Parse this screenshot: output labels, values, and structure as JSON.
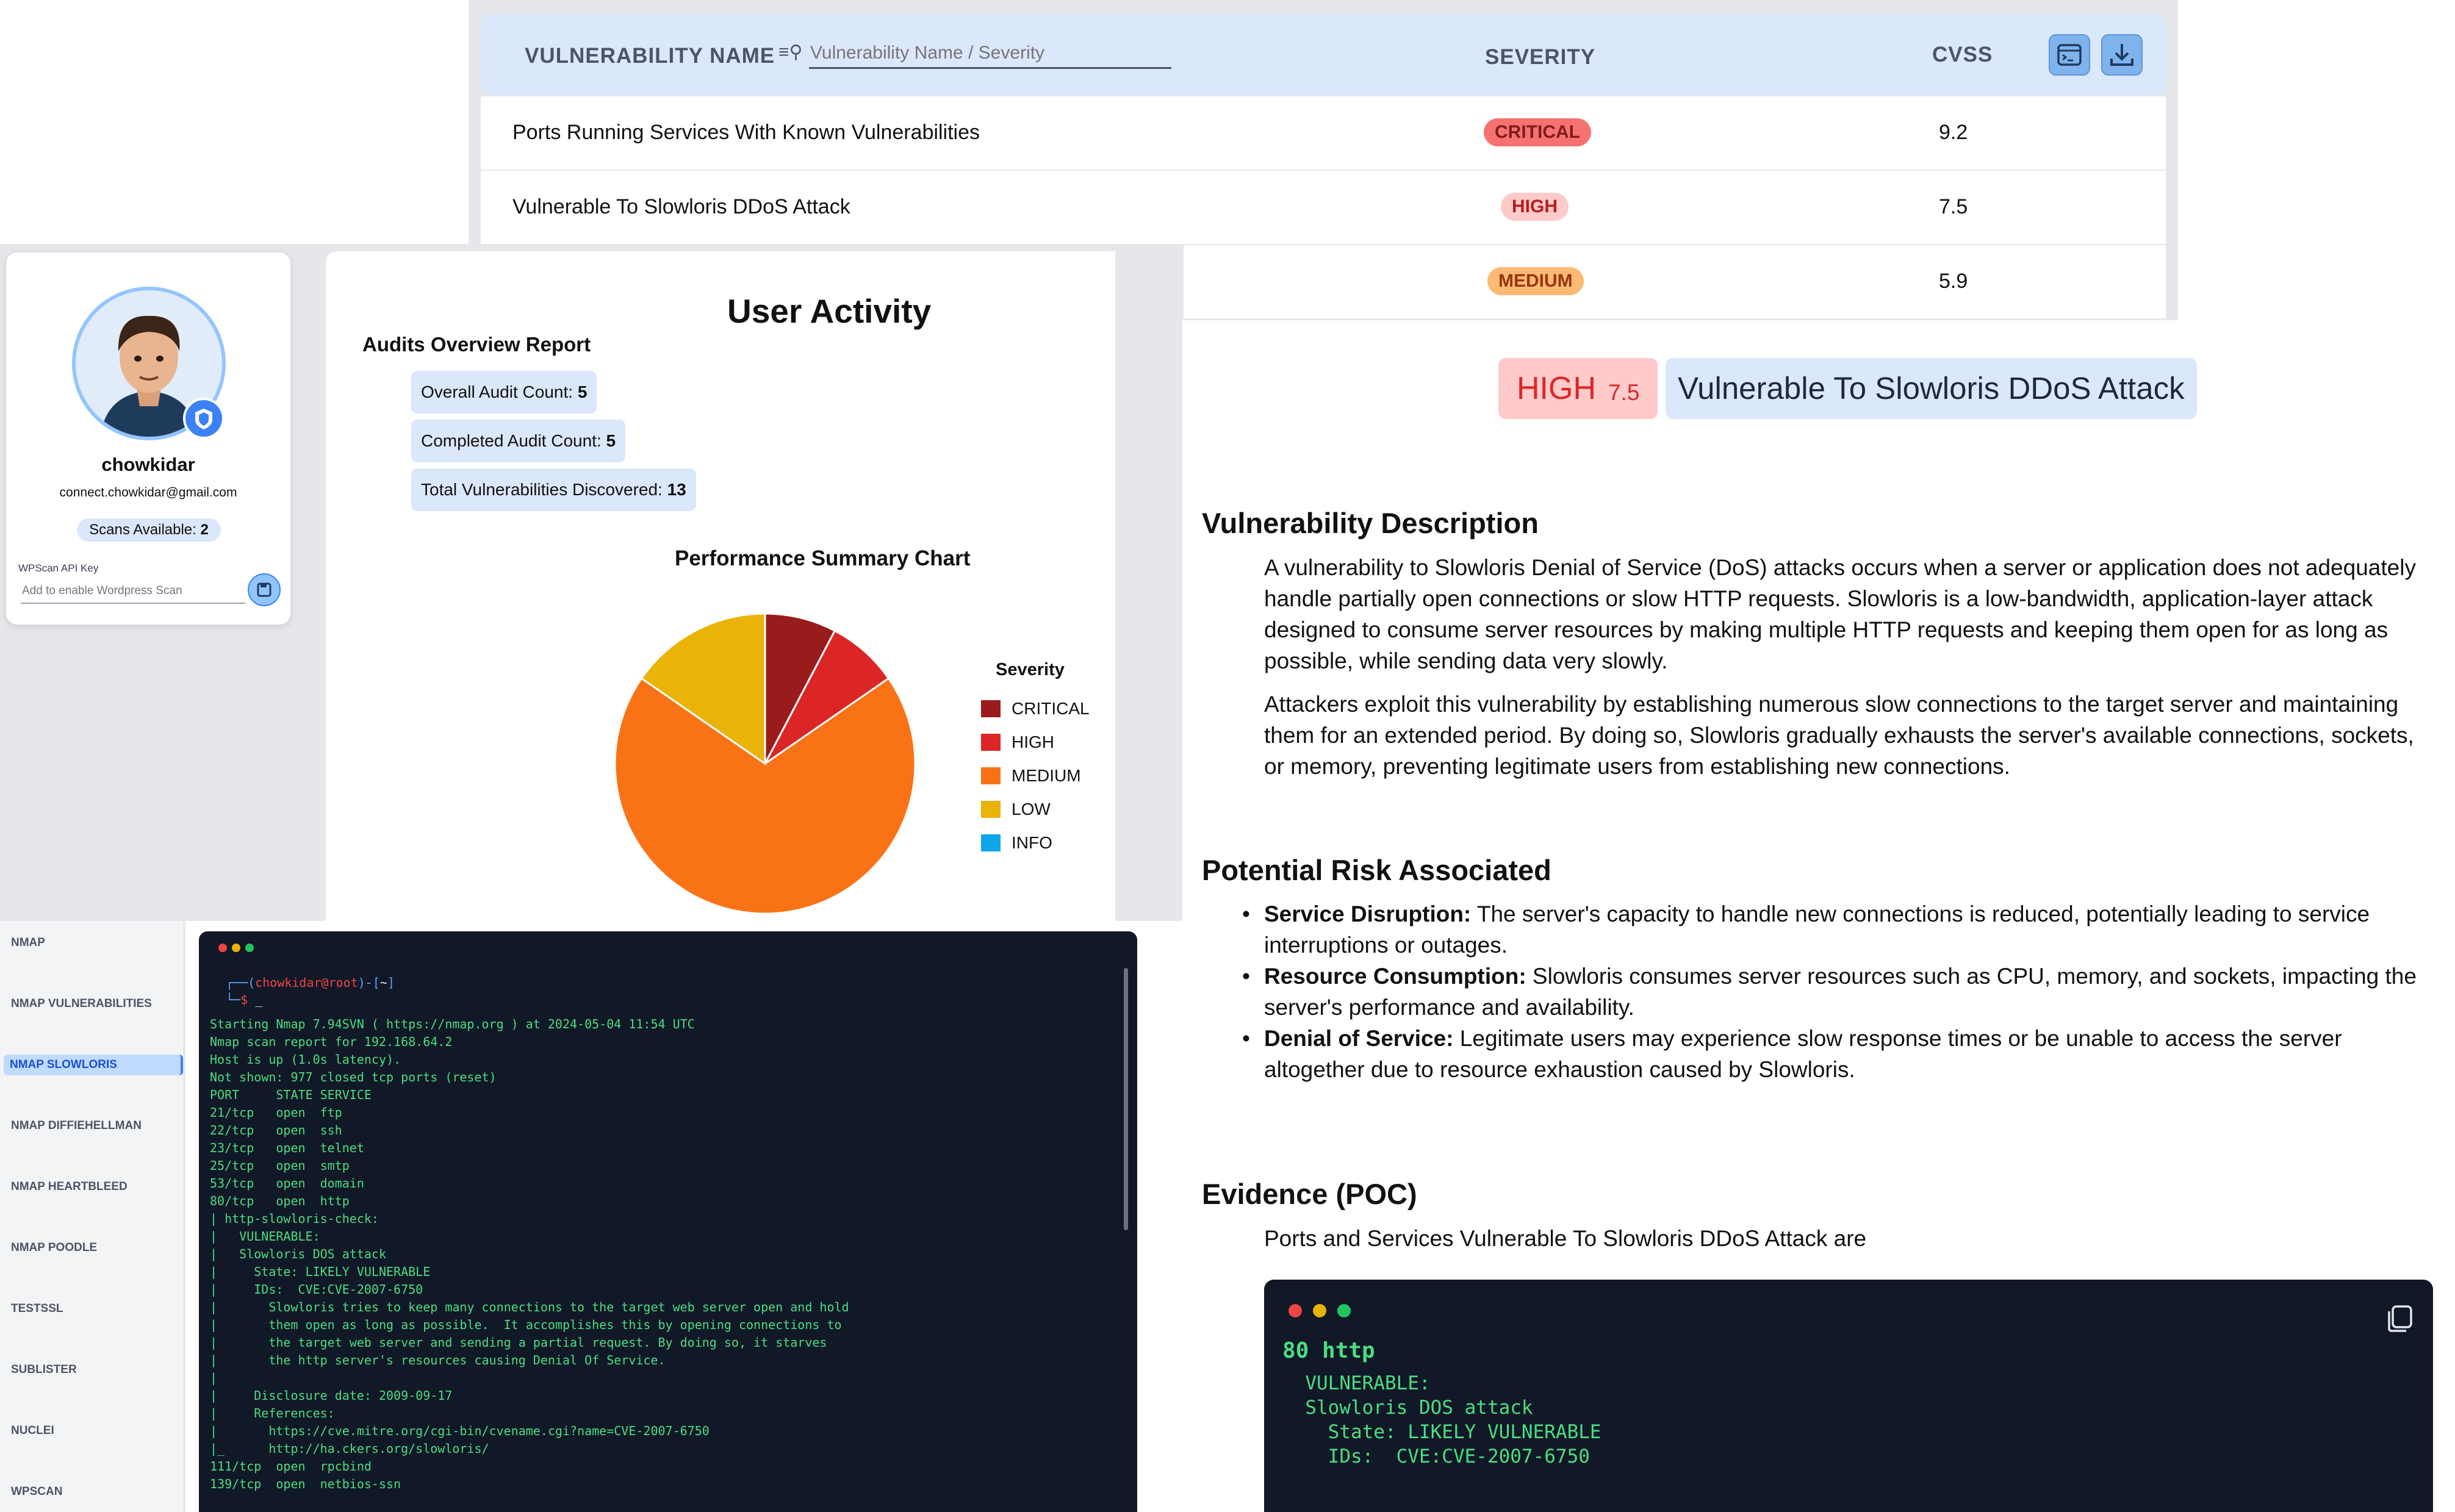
{
  "table": {
    "header": {
      "name": "VULNERABILITY NAME",
      "search_placeholder": "Vulnerability Name / Severity",
      "severity": "SEVERITY",
      "cvss": "CVSS"
    },
    "rows": [
      {
        "name": "Ports Running Services With Known Vulnerabilities",
        "severity": "CRITICAL",
        "cvss": "9.2",
        "color": "#f87171",
        "text": "#7f1d1d"
      },
      {
        "name": "Vulnerable To Slowloris DDoS Attack",
        "severity": "HIGH",
        "cvss": "7.5",
        "color": "#fecaca",
        "text": "#b91c1c"
      },
      {
        "name": "",
        "severity": "MEDIUM",
        "cvss": "5.9",
        "color": "#fdba74",
        "text": "#9a3412"
      }
    ]
  },
  "profile": {
    "username": "chowkidar",
    "email": "connect.chowkidar@gmail.com",
    "scans": "Scans Available: ",
    "scans_count": "2",
    "wpscan_label": "WPScan API Key",
    "wpscan_placeholder": "Add to enable Wordpress Scan"
  },
  "activity": {
    "title": "User Activity",
    "report_title": "Audits Overview Report",
    "overall_label": "Overall Audit Count: ",
    "overall": "5",
    "completed_label": "Completed Audit Count: ",
    "completed": "5",
    "total_label": "Total Vulnerabilities Discovered: ",
    "total": "13",
    "chart_title": "Performance Summary Chart"
  },
  "chart_data": {
    "type": "pie",
    "title": "Performance Summary Chart",
    "legend_title": "Severity",
    "legend_position": "right",
    "categories": [
      "CRITICAL",
      "HIGH",
      "MEDIUM",
      "LOW",
      "INFO"
    ],
    "values": [
      1,
      1,
      9,
      2,
      0
    ],
    "colors": [
      "#991b1b",
      "#dc2626",
      "#f97316",
      "#eab308",
      "#0ea5e9"
    ]
  },
  "nav": {
    "items": [
      "NMAP",
      "NMAP VULNERABILITIES",
      "NMAP SLOWLORIS",
      "NMAP DIFFIEHELLMAN",
      "NMAP HEARTBLEED",
      "NMAP POODLE",
      "TESTSSL",
      "SUBLISTER",
      "NUCLEI",
      "WPSCAN"
    ],
    "active": "NMAP SLOWLORIS"
  },
  "terminal": {
    "prompt_user": "chowkidar@root",
    "prompt_dir": "~",
    "lines": [
      "Starting Nmap 7.94SVN ( https://nmap.org ) at 2024-05-04 11:54 UTC",
      "Nmap scan report for 192.168.64.2",
      "Host is up (1.0s latency).",
      "Not shown: 977 closed tcp ports (reset)",
      "PORT     STATE SERVICE",
      "21/tcp   open  ftp",
      "22/tcp   open  ssh",
      "23/tcp   open  telnet",
      "25/tcp   open  smtp",
      "53/tcp   open  domain",
      "80/tcp   open  http",
      "| http-slowloris-check:",
      "|   VULNERABLE:",
      "|   Slowloris DOS attack",
      "|     State: LIKELY VULNERABLE",
      "|     IDs:  CVE:CVE-2007-6750",
      "|       Slowloris tries to keep many connections to the target web server open and hold",
      "|       them open as long as possible.  It accomplishes this by opening connections to",
      "|       the target web server and sending a partial request. By doing so, it starves",
      "|       the http server's resources causing Denial Of Service.",
      "|",
      "|     Disclosure date: 2009-09-17",
      "|     References:",
      "|       https://cve.mitre.org/cgi-bin/cvename.cgi?name=CVE-2007-6750",
      "|_      http://ha.ckers.org/slowloris/",
      "111/tcp  open  rpcbind",
      "139/tcp  open  netbios-ssn"
    ]
  },
  "detail": {
    "severity": "HIGH",
    "score": "7.5",
    "title": "Vulnerable To Slowloris DDoS Attack",
    "desc_heading": "Vulnerability Description",
    "desc_p1": "A vulnerability to Slowloris Denial of Service (DoS) attacks occurs when a server or application does not adequately handle partially open connections or slow HTTP requests. Slowloris is a low-bandwidth, application-layer attack designed to consume server resources by making multiple HTTP requests and keeping them open for as long as possible, while sending data very slowly.",
    "desc_p2": "Attackers exploit this vulnerability by establishing numerous slow connections to the target server and maintaining them for an extended period. By doing so, Slowloris gradually exhausts the server's available connections, sockets, or memory, preventing legitimate users from establishing new connections.",
    "risk_heading": "Potential Risk Associated",
    "risks": [
      {
        "term": "Service Disruption:",
        "text": " The server's capacity to handle new connections is reduced, potentially leading to service interruptions or outages."
      },
      {
        "term": "Resource Consumption:",
        "text": " Slowloris consumes server resources such as CPU, memory, and sockets, impacting the server's performance and availability."
      },
      {
        "term": "Denial of Service:",
        "text": " Legitimate users may experience slow response times or be unable to access the server altogether due to resource exhaustion caused by Slowloris."
      }
    ],
    "evidence_heading": "Evidence (POC)",
    "evidence_intro": "Ports and Services Vulnerable To Slowloris DDoS Attack are",
    "evidence_port": "80 http",
    "evidence_lines": [
      "  VULNERABLE:",
      "  Slowloris DOS attack",
      "    State: LIKELY VULNERABLE",
      "    IDs:  CVE:CVE-2007-6750"
    ]
  }
}
